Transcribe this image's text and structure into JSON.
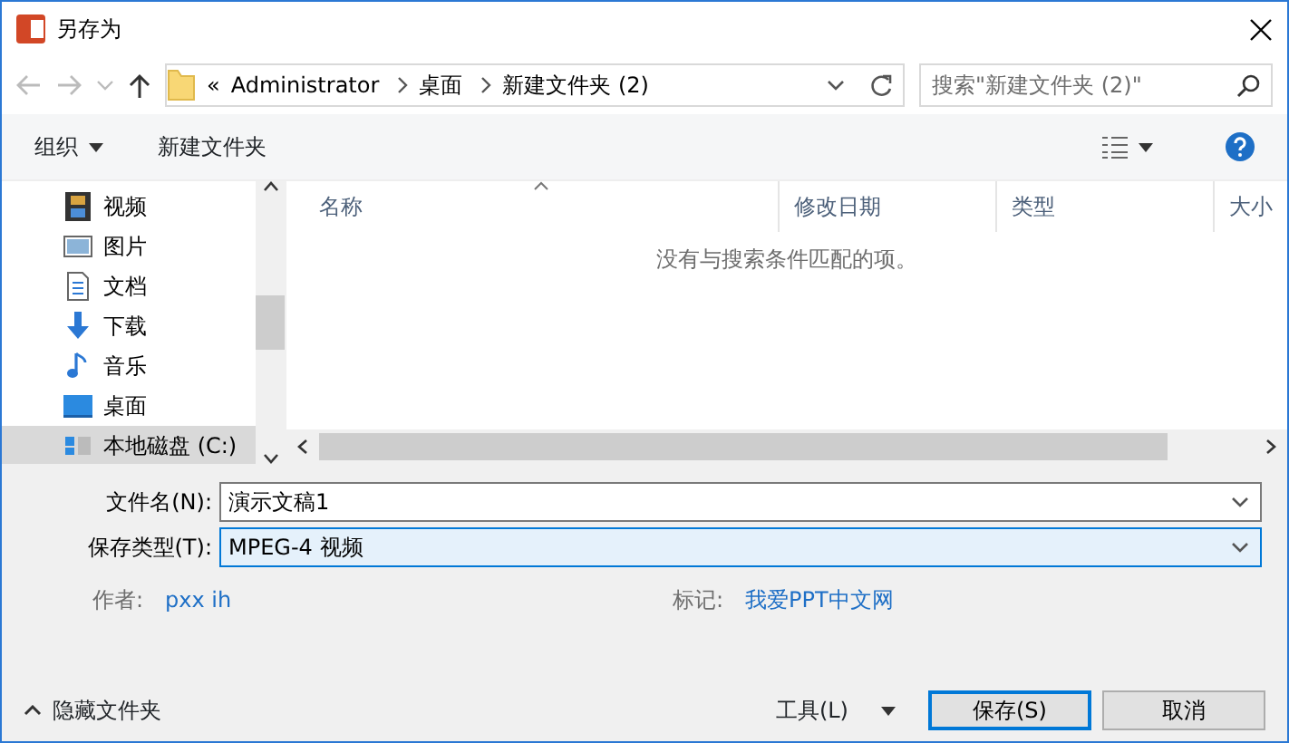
{
  "window": {
    "title": "另存为"
  },
  "address": {
    "breadcrumbs": [
      "«",
      "Administrator",
      "桌面",
      "新建文件夹 (2)"
    ]
  },
  "search": {
    "placeholder": "搜索\"新建文件夹 (2)\""
  },
  "toolbar": {
    "organize": "组织",
    "new_folder": "新建文件夹"
  },
  "sidebar": {
    "items": [
      {
        "label": "视频",
        "kind": "video",
        "selected": false
      },
      {
        "label": "图片",
        "kind": "picture",
        "selected": false
      },
      {
        "label": "文档",
        "kind": "document",
        "selected": false
      },
      {
        "label": "下载",
        "kind": "download",
        "selected": false
      },
      {
        "label": "音乐",
        "kind": "music",
        "selected": false
      },
      {
        "label": "桌面",
        "kind": "desktop",
        "selected": false
      },
      {
        "label": "本地磁盘 (C:)",
        "kind": "drive",
        "selected": true
      }
    ]
  },
  "table": {
    "columns": [
      "名称",
      "修改日期",
      "类型",
      "大小"
    ],
    "empty_message": "没有与搜索条件匹配的项。"
  },
  "form": {
    "file_name": {
      "label": "文件名(N):",
      "value": "演示文稿1"
    },
    "save_type": {
      "label": "保存类型(T):",
      "value": "MPEG-4 视频"
    },
    "author": {
      "label": "作者:",
      "value": "pxx ih"
    },
    "tags": {
      "label": "标记:",
      "value": "我爱PPT中文网"
    }
  },
  "footer": {
    "hide_folders": "隐藏文件夹",
    "tools": "工具(L)",
    "buttons": [
      "保存(S)",
      "取消"
    ]
  }
}
